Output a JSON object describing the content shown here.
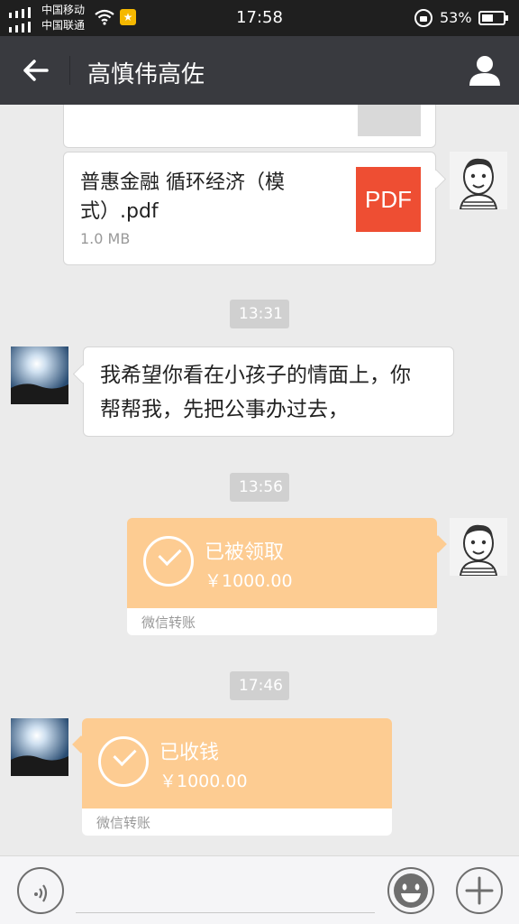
{
  "status_bar": {
    "carrier_1": "中国移动",
    "carrier_2": "中国联通",
    "time": "17:58",
    "battery_percent": "53%",
    "battery_level": 0.53,
    "star_badge": "★"
  },
  "header": {
    "title": "高慎伟高佐",
    "back_icon": "arrow-left-icon",
    "profile_icon": "person-icon"
  },
  "messages": {
    "file": {
      "name": "普惠金融 循环经济（模式）.pdf",
      "size": "1.0 MB",
      "badge": "PDF"
    },
    "timestamps": [
      "13:31",
      "13:56",
      "17:46"
    ],
    "text_message": "我希望你看在小孩子的情面上，你\n帮帮我，先把公事办过去，",
    "transfers": [
      {
        "status": "已被领取",
        "amount": "￥1000.00",
        "footer": "微信转账"
      },
      {
        "status": "已收钱",
        "amount": "￥1000.00",
        "footer": "微信转账"
      }
    ]
  },
  "input_bar": {
    "voice_icon": "voice-icon",
    "emoji_icon": "emoji-icon",
    "plus_icon": "plus-icon"
  },
  "colors": {
    "header_bg": "#393a3f",
    "status_bg": "#1f1f1f",
    "chat_bg": "#ebebeb",
    "transfer_orange": "#fdcc92",
    "pdf_red": "#ee4e33"
  }
}
